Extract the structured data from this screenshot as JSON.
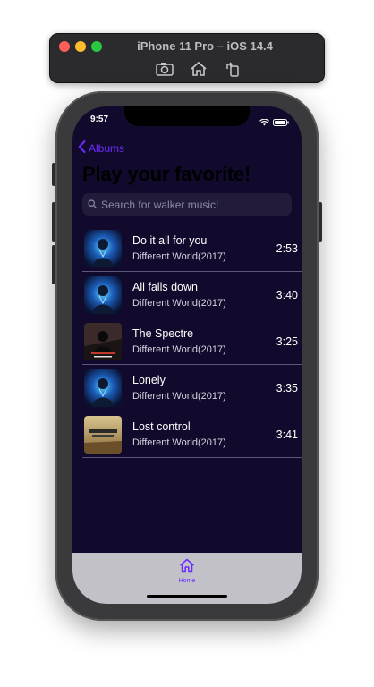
{
  "simulator": {
    "title": "iPhone 11 Pro – iOS 14.4",
    "tools": [
      "camera-icon",
      "home-icon",
      "rotate-icon"
    ]
  },
  "status_bar": {
    "time": "9:57"
  },
  "nav": {
    "back_label": "Albums"
  },
  "page": {
    "title": "Play your favorite!"
  },
  "search": {
    "placeholder": "Search for walker music!"
  },
  "songs": [
    {
      "title": "Do it all for you",
      "album": "Different World(2017)",
      "duration": "2:53",
      "art": "blue"
    },
    {
      "title": "All falls down",
      "album": "Different World(2017)",
      "duration": "3:40",
      "art": "blue"
    },
    {
      "title": "The Spectre",
      "album": "Different World(2017)",
      "duration": "3:25",
      "art": "red"
    },
    {
      "title": "Lonely",
      "album": "Different World(2017)",
      "duration": "3:35",
      "art": "blue"
    },
    {
      "title": "Lost control",
      "album": "Different World(2017)",
      "duration": "3:41",
      "art": "gold"
    }
  ],
  "tab_bar": {
    "home_label": "Home"
  },
  "colors": {
    "accent": "#6b2bff",
    "background": "#120a2c",
    "tab_bar": "#c3c1c8"
  }
}
